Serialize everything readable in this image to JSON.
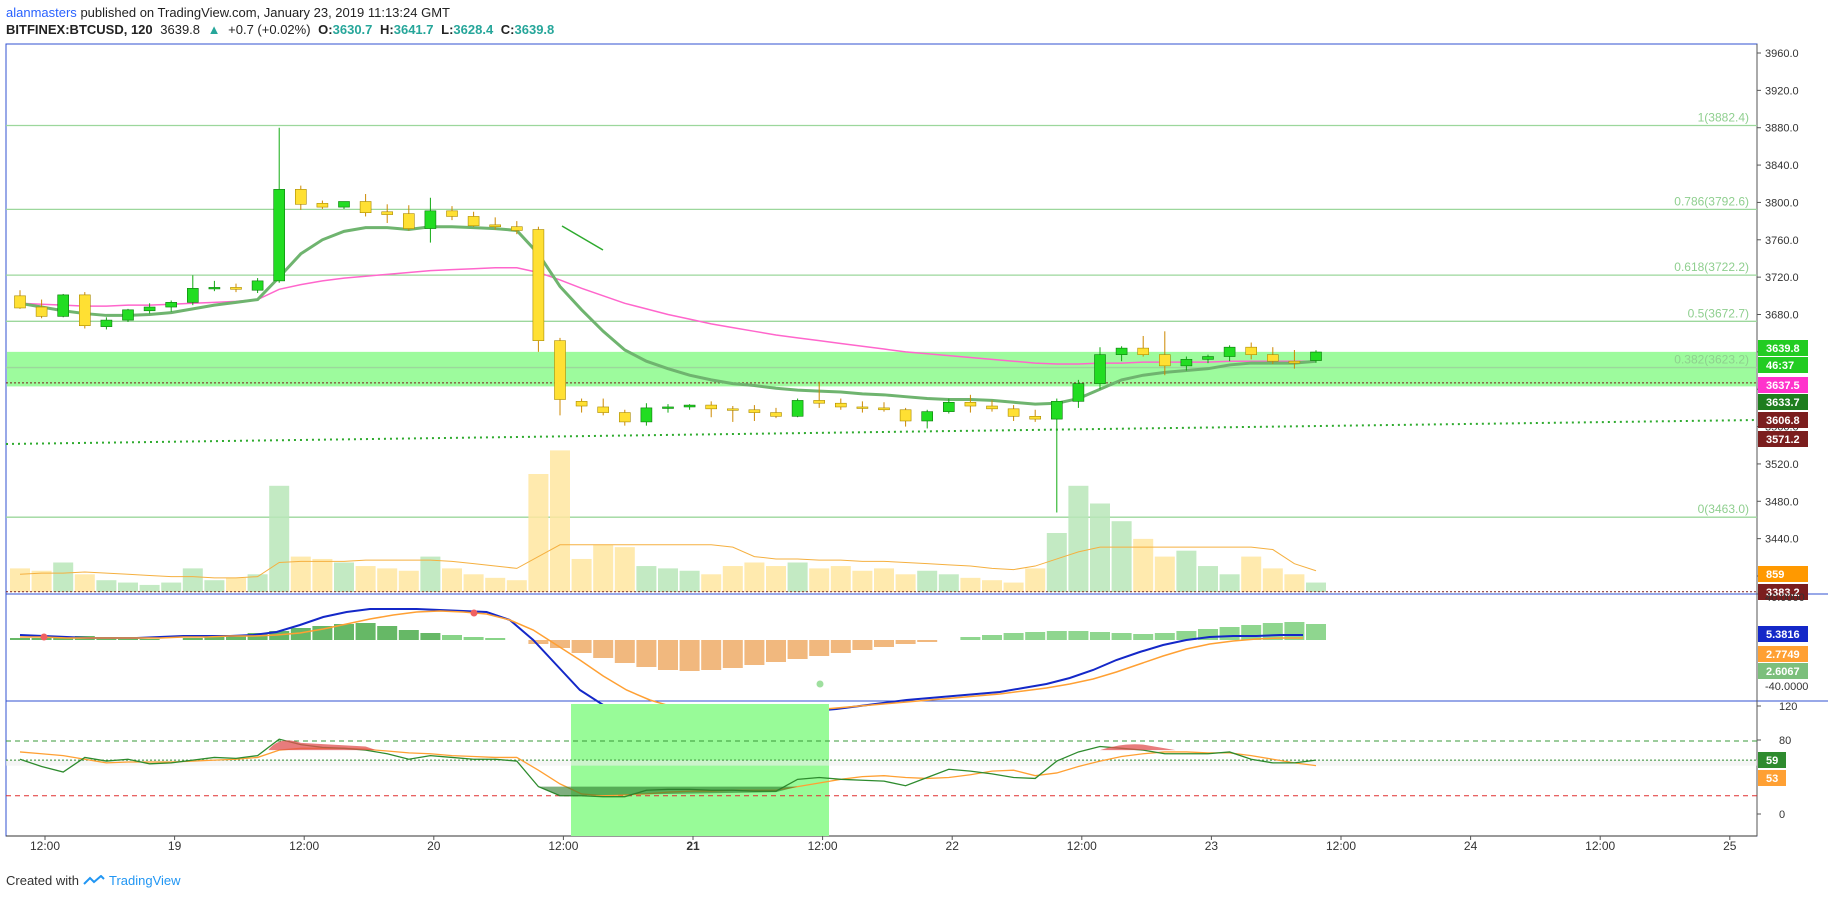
{
  "header": {
    "author": "alanmasters",
    "published_text": "published on TradingView.com, January 23, 2019 11:13:24 GMT",
    "symbol": "BITFINEX:BTCUSD, 120",
    "last": "3639.8",
    "change": "+0.7 (+0.02%)",
    "o_label": "O:",
    "o_value": "3630.7",
    "h_label": "H:",
    "h_value": "3641.7",
    "l_label": "L:",
    "l_value": "3628.4",
    "c_label": "C:",
    "c_value": "3639.8"
  },
  "footer": {
    "created_with": "Created with",
    "brand": "TradingView"
  },
  "colors": {
    "bull": "#22dd22",
    "bear": "#ffe033",
    "ema_fast": "#6fb46f",
    "ema_slow": "#ff66cc",
    "fib": "#9cd79c",
    "support_zone": "#98fb98",
    "macd": "#1428c8",
    "signal": "#ffa033",
    "rsi": "#2e8b2e",
    "rsi_ma": "#ffa033",
    "frame": "#3050d0"
  },
  "chart_data": [
    {
      "type": "candlestick",
      "title": "BITFINEX:BTCUSD, 120",
      "ylim": [
        3380,
        3980
      ],
      "y_ticks": [
        "3960.0",
        "3920.0",
        "3880.0",
        "3840.0",
        "3800.0",
        "3760.0",
        "3720.0",
        "3680.0",
        "3640.0",
        "3600.0",
        "3560.0",
        "3520.0",
        "3480.0",
        "3440.0",
        "3400.0"
      ],
      "x_ticks": [
        "12:00",
        "19",
        "12:00",
        "20",
        "12:00",
        "21",
        "12:00",
        "22",
        "12:00",
        "23",
        "12:00",
        "24",
        "12:00",
        "25"
      ],
      "fib_levels": [
        {
          "label": "1(3882.4)",
          "value": 3882.4
        },
        {
          "label": "0.786(3792.6)",
          "value": 3792.6
        },
        {
          "label": "0.618(3722.2)",
          "value": 3722.2
        },
        {
          "label": "0.5(3672.7)",
          "value": 3672.7
        },
        {
          "label": "0.382(3623.2)",
          "value": 3623.2
        },
        {
          "label": "0(3463.0)",
          "value": 3463.0
        }
      ],
      "support_zone": [
        3603,
        3640
      ],
      "price_labels": [
        {
          "text": "3639.8",
          "value": 3639.8,
          "color": "#22cc22"
        },
        {
          "text": "46:37",
          "value": 3625,
          "color": "#22cc22"
        },
        {
          "text": "3637.5",
          "value": 3637.5,
          "color": "#ff33cc"
        },
        {
          "text": "3633.7",
          "value": 3633.7,
          "color": "#1e7d1e"
        },
        {
          "text": "3606.8",
          "value": 3606.8,
          "color": "#7b1e1e"
        },
        {
          "text": "3571.2",
          "value": 3571.2,
          "color": "#7b1e1e"
        },
        {
          "text": "859",
          "value": 3403,
          "color": "#ff9900"
        },
        {
          "text": "3383.2",
          "value": 3383.2,
          "color": "#7b1e1e"
        }
      ],
      "candles": [
        [
          3700,
          3706,
          3686,
          3687
        ],
        [
          3688,
          3696,
          3676,
          3678
        ],
        [
          3678,
          3702,
          3677,
          3701
        ],
        [
          3701,
          3704,
          3665,
          3668
        ],
        [
          3667,
          3677,
          3664,
          3674
        ],
        [
          3674,
          3686,
          3672,
          3685
        ],
        [
          3684,
          3692,
          3681,
          3688
        ],
        [
          3688,
          3695,
          3683,
          3693
        ],
        [
          3693,
          3722,
          3690,
          3708
        ],
        [
          3708,
          3716,
          3705,
          3709
        ],
        [
          3709,
          3713,
          3704,
          3707
        ],
        [
          3706,
          3719,
          3703,
          3716
        ],
        [
          3716,
          3880,
          3714,
          3814
        ],
        [
          3814,
          3818,
          3792,
          3798
        ],
        [
          3799,
          3802,
          3793,
          3795
        ],
        [
          3795,
          3801,
          3793,
          3801
        ],
        [
          3801,
          3809,
          3785,
          3789
        ],
        [
          3790,
          3798,
          3778,
          3787
        ],
        [
          3788,
          3797,
          3770,
          3772
        ],
        [
          3772,
          3805,
          3757,
          3791
        ],
        [
          3791,
          3796,
          3781,
          3785
        ],
        [
          3785,
          3790,
          3774,
          3775
        ],
        [
          3776,
          3784,
          3771,
          3774
        ],
        [
          3774,
          3780,
          3766,
          3770
        ],
        [
          3771,
          3774,
          3640,
          3652
        ],
        [
          3652,
          3655,
          3572,
          3589
        ],
        [
          3587,
          3590,
          3575,
          3582
        ],
        [
          3581,
          3590,
          3572,
          3575
        ],
        [
          3575,
          3578,
          3561,
          3565
        ],
        [
          3565,
          3585,
          3561,
          3580
        ],
        [
          3580,
          3584,
          3575,
          3581
        ],
        [
          3581,
          3584,
          3578,
          3583
        ],
        [
          3583,
          3587,
          3570,
          3579
        ],
        [
          3579,
          3582,
          3565,
          3578
        ],
        [
          3578,
          3583,
          3566,
          3575
        ],
        [
          3575,
          3580,
          3569,
          3571
        ],
        [
          3571,
          3590,
          3570,
          3588
        ],
        [
          3588,
          3608,
          3580,
          3585
        ],
        [
          3585,
          3590,
          3578,
          3581
        ],
        [
          3581,
          3587,
          3575,
          3580
        ],
        [
          3580,
          3586,
          3576,
          3578
        ],
        [
          3578,
          3580,
          3560,
          3566
        ],
        [
          3566,
          3578,
          3558,
          3576
        ],
        [
          3576,
          3590,
          3574,
          3586
        ],
        [
          3586,
          3594,
          3575,
          3582
        ],
        [
          3582,
          3588,
          3576,
          3579
        ],
        [
          3579,
          3583,
          3566,
          3571
        ],
        [
          3571,
          3578,
          3565,
          3568
        ],
        [
          3568,
          3590,
          3468,
          3587
        ],
        [
          3587,
          3610,
          3580,
          3606
        ],
        [
          3606,
          3645,
          3600,
          3637
        ],
        [
          3637,
          3646,
          3630,
          3644
        ],
        [
          3644,
          3657,
          3635,
          3637
        ],
        [
          3637,
          3662,
          3615,
          3625
        ],
        [
          3625,
          3635,
          3620,
          3632
        ],
        [
          3632,
          3637,
          3628,
          3635
        ],
        [
          3635,
          3647,
          3630,
          3645
        ],
        [
          3645,
          3650,
          3632,
          3637
        ],
        [
          3637,
          3645,
          3627,
          3630
        ],
        [
          3630,
          3642,
          3622,
          3628
        ],
        [
          3630.7,
          3641.7,
          3628.4,
          3639.8
        ]
      ],
      "ema_fast": [
        3692,
        3688,
        3684,
        3681,
        3679,
        3679,
        3680,
        3682,
        3686,
        3690,
        3693,
        3696,
        3720,
        3745,
        3760,
        3769,
        3773,
        3773,
        3771,
        3774,
        3774,
        3773,
        3772,
        3770,
        3745,
        3710,
        3685,
        3662,
        3642,
        3630,
        3622,
        3615,
        3610,
        3606,
        3604,
        3601,
        3599,
        3598,
        3597,
        3595,
        3594,
        3592,
        3590,
        3589,
        3589,
        3588,
        3586,
        3584,
        3585,
        3590,
        3600,
        3610,
        3615,
        3618,
        3620,
        3622,
        3626,
        3628,
        3628,
        3628,
        3630
      ],
      "ema_slow": [
        3692,
        3691,
        3690,
        3689,
        3689,
        3690,
        3690,
        3691,
        3692,
        3693,
        3694,
        3696,
        3707,
        3712,
        3716,
        3719,
        3721,
        3723,
        3725,
        3727,
        3728,
        3729,
        3730,
        3730,
        3725,
        3717,
        3708,
        3700,
        3692,
        3686,
        3680,
        3675,
        3670,
        3666,
        3662,
        3658,
        3655,
        3652,
        3649,
        3646,
        3643,
        3640,
        3638,
        3636,
        3634,
        3632,
        3630,
        3628,
        3627,
        3627,
        3628,
        3628,
        3629,
        3629,
        3629,
        3629,
        3630,
        3630,
        3630,
        3630,
        3630
      ],
      "volume": [
        20,
        18,
        25,
        15,
        10,
        8,
        6,
        8,
        20,
        10,
        12,
        15,
        90,
        30,
        28,
        25,
        22,
        20,
        18,
        30,
        20,
        15,
        12,
        10,
        100,
        120,
        28,
        40,
        38,
        22,
        20,
        18,
        15,
        22,
        25,
        22,
        25,
        20,
        22,
        18,
        20,
        15,
        18,
        15,
        12,
        10,
        8,
        20,
        50,
        90,
        75,
        60,
        45,
        30,
        35,
        22,
        15,
        30,
        20,
        15,
        8
      ],
      "volume_ma": [
        15,
        16,
        16,
        17,
        16,
        15,
        14,
        13,
        13,
        12,
        12,
        13,
        25,
        26,
        26,
        26,
        27,
        27,
        27,
        27,
        26,
        24,
        22,
        20,
        30,
        40,
        40,
        40,
        40,
        40,
        40,
        40,
        40,
        38,
        30,
        28,
        28,
        27,
        27,
        26,
        26,
        25,
        24,
        23,
        22,
        20,
        19,
        22,
        28,
        34,
        38,
        38,
        38,
        38,
        38,
        38,
        38,
        38,
        36,
        24,
        18
      ]
    },
    {
      "type": "macd",
      "y_ticks": [
        "40.0000",
        "-40.0000"
      ],
      "labels": [
        {
          "text": "5.3816",
          "color": "#1428c8"
        },
        {
          "text": "2.7749",
          "color": "#ffa033"
        },
        {
          "text": "2.6067",
          "color": "#7cbf7c"
        }
      ]
    },
    {
      "type": "rsi",
      "y_ticks": [
        "120",
        "80",
        "0"
      ],
      "ylim": [
        -20,
        120
      ],
      "levels": [
        80,
        20
      ],
      "labels": [
        {
          "text": "59",
          "value": 59,
          "color": "#2e8b2e"
        },
        {
          "text": "53",
          "value": 53,
          "color": "#ffa033"
        }
      ]
    }
  ]
}
